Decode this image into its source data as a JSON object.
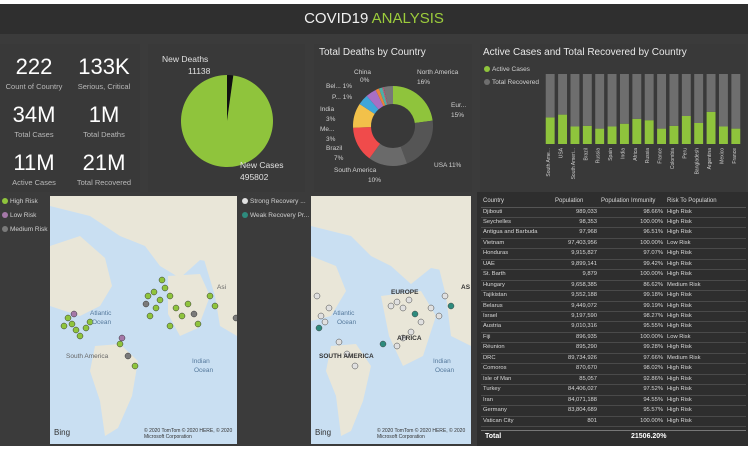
{
  "header": {
    "title_part1": "COVID19 ",
    "title_part2": "ANALYSIS"
  },
  "kpis": [
    {
      "value": "222",
      "label": "Count of Country"
    },
    {
      "value": "133K",
      "label": "Serious, Critical"
    },
    {
      "value": "34M",
      "label": "Total Cases"
    },
    {
      "value": "1M",
      "label": "Total Deaths"
    },
    {
      "value": "11M",
      "label": "Active Cases"
    },
    {
      "value": "21M",
      "label": "Total Recovered"
    }
  ],
  "pie": {
    "legend_label": "New Deaths",
    "deaths_value": "11138",
    "cases_label": "New Cases",
    "cases_value": "495802",
    "chart_data": {
      "type": "pie",
      "categories": [
        "New Deaths",
        "New Cases"
      ],
      "values": [
        11138,
        495802
      ]
    }
  },
  "donut": {
    "title": "Total Deaths by Country",
    "labels": {
      "china": "China",
      "china_pct": "0%",
      "bel": "Bel... 1%",
      "p": "P... 1%",
      "india": "India",
      "india_pct": "3%",
      "me": "Me...",
      "me_pct": "3%",
      "brazil": "Brazil",
      "brazil_pct": "7%",
      "sa": "South America",
      "sa_pct": "10%",
      "usa": "USA 11%",
      "eu": "Eur...",
      "eu_pct": "15%",
      "na": "North America",
      "na_pct": "16%"
    },
    "chart_data": {
      "type": "pie",
      "categories": [
        "North America",
        "Europe",
        "USA",
        "South America",
        "Brazil",
        "India",
        "Mexico",
        "P...",
        "Bel...",
        "China"
      ],
      "values": [
        16,
        15,
        11,
        10,
        7,
        3,
        3,
        1,
        1,
        0
      ]
    }
  },
  "bar": {
    "title": "Active Cases and Total Recovered by Country",
    "legend_active": "Active Cases",
    "legend_recovered": "Total Recovered",
    "colors": {
      "active": "#8fc43c",
      "recovered": "#6e6e6e"
    },
    "chart_data": {
      "type": "bar",
      "categories": [
        "South Ame...",
        "USA",
        "South Ameri...",
        "Brazil",
        "Russia",
        "Spain",
        "India",
        "Africa",
        "Russia",
        "France",
        "Colombia",
        "Peru",
        "Bangladesh",
        "Argentina",
        "Mexico",
        "France"
      ],
      "series": [
        {
          "name": "Active Cases",
          "values": [
            38,
            42,
            25,
            26,
            22,
            25,
            29,
            36,
            34,
            22,
            26,
            40,
            30,
            46,
            25,
            22
          ]
        },
        {
          "name": "Total Recovered",
          "values": [
            62,
            58,
            75,
            74,
            78,
            75,
            71,
            64,
            66,
            78,
            74,
            60,
            70,
            54,
            75,
            78
          ]
        }
      ],
      "ylim": [
        0,
        100
      ]
    }
  },
  "map1": {
    "legend": [
      "High Risk",
      "Low Risk",
      "Medium Risk"
    ],
    "labels": {
      "atlantic": "Atlantic",
      "ocean": "Ocean",
      "south_america": "South America",
      "asia": "Asi",
      "indian": "Indian",
      "indian_ocean": "Ocean"
    },
    "credit": "© 2020 TomTom © 2020 HERE, © 2020 Microsoft Corporation",
    "bing": "Bing"
  },
  "map2": {
    "legend": [
      "Strong Recovery ...",
      "Weak Recovery Pr..."
    ],
    "labels": {
      "europe": "EUROPE",
      "atlantic": "Atlantic",
      "ocean": "Ocean",
      "africa": "AFRICA",
      "south_america": "SOUTH AMERICA",
      "indian": "Indian",
      "indian_ocean": "Ocean",
      "as": "AS"
    },
    "credit": "© 2020 TomTom © 2020 HERE, © 2020 Microsoft Corporation",
    "bing": "Bing"
  },
  "table": {
    "headers": [
      "Country",
      "Population",
      "Population Immunity",
      "Risk To Population"
    ],
    "rows": [
      [
        "Djibouti",
        "989,033",
        "98.66%",
        "High Risk"
      ],
      [
        "Seychelles",
        "98,353",
        "100.00%",
        "High Risk"
      ],
      [
        "Antigua and Barbuda",
        "97,968",
        "96.51%",
        "High Risk"
      ],
      [
        "Vietnam",
        "97,403,956",
        "100.00%",
        "Low Risk"
      ],
      [
        "Honduras",
        "9,915,827",
        "97.07%",
        "High Risk"
      ],
      [
        "UAE",
        "9,899,141",
        "99.42%",
        "High Risk"
      ],
      [
        "St. Barth",
        "9,879",
        "100.00%",
        "High Risk"
      ],
      [
        "Hungary",
        "9,658,385",
        "86.62%",
        "Medium Risk"
      ],
      [
        "Tajikistan",
        "9,552,188",
        "99.18%",
        "High Risk"
      ],
      [
        "Belarus",
        "9,449,072",
        "99.19%",
        "High Risk"
      ],
      [
        "Israel",
        "9,197,590",
        "98.27%",
        "High Risk"
      ],
      [
        "Austria",
        "9,010,316",
        "95.55%",
        "High Risk"
      ],
      [
        "Fiji",
        "896,935",
        "100.00%",
        "Low Risk"
      ],
      [
        "Réunion",
        "895,290",
        "99.28%",
        "High Risk"
      ],
      [
        "DRC",
        "89,734,926",
        "97.66%",
        "Medium Risk"
      ],
      [
        "Comoros",
        "870,670",
        "98.02%",
        "High Risk"
      ],
      [
        "Isle of Man",
        "85,057",
        "92.86%",
        "High Risk"
      ],
      [
        "Turkey",
        "84,406,027",
        "97.52%",
        "High Risk"
      ],
      [
        "Iran",
        "84,071,188",
        "94.55%",
        "High Risk"
      ],
      [
        "Germany",
        "83,804,689",
        "95.57%",
        "High Risk"
      ],
      [
        "Vatican City",
        "801",
        "100.00%",
        "High Risk"
      ]
    ],
    "total_label": "Total",
    "total_value": "21506.20%"
  }
}
